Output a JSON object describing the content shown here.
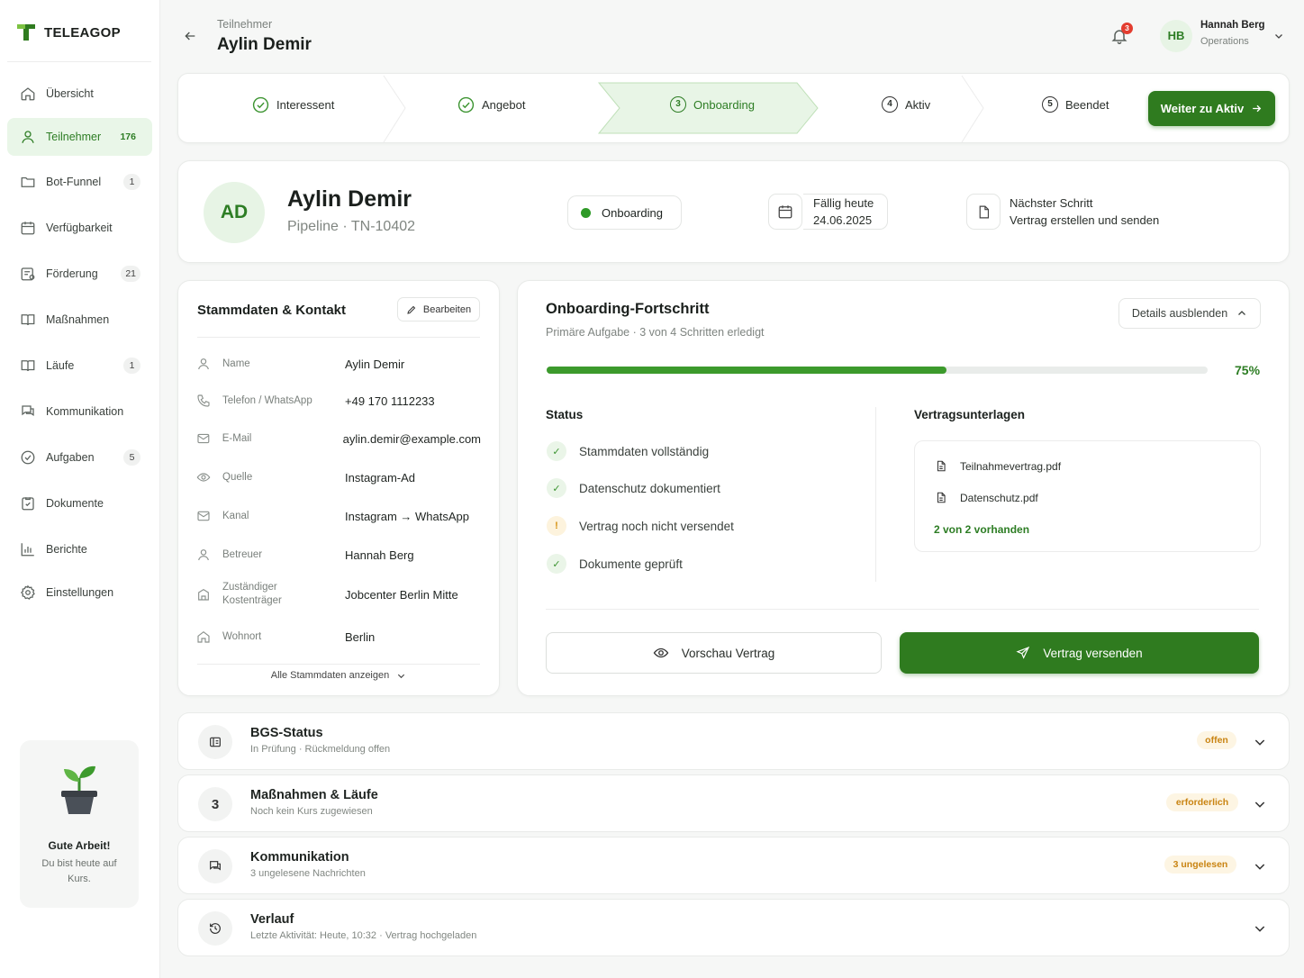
{
  "app": {
    "name": "TELEAGOP"
  },
  "sidebar": {
    "items": [
      {
        "label": "Übersicht",
        "badge": ""
      },
      {
        "label": "Teilnehmer",
        "badge": "176"
      },
      {
        "label": "Bot-Funnel",
        "badge": "1"
      },
      {
        "label": "Verfügbarkeit",
        "badge": ""
      },
      {
        "label": "Förderung",
        "badge": "21"
      },
      {
        "label": "Maßnahmen",
        "badge": ""
      },
      {
        "label": "Läufe",
        "badge": "1"
      },
      {
        "label": "Kommunikation",
        "badge": ""
      },
      {
        "label": "Aufgaben",
        "badge": "5"
      },
      {
        "label": "Dokumente",
        "badge": ""
      },
      {
        "label": "Berichte",
        "badge": ""
      },
      {
        "label": "Einstellungen",
        "badge": ""
      }
    ],
    "promo": {
      "title": "Gute Arbeit!",
      "text": "Du bist heute auf Kurs."
    }
  },
  "header": {
    "breadcrumb": "Teilnehmer",
    "title": "Aylin Demir",
    "notifications": "3",
    "user": {
      "initials": "HB",
      "name": "Hannah Berg",
      "role": "Operations"
    }
  },
  "stepper": {
    "steps": [
      {
        "number": "",
        "label": "Interessent"
      },
      {
        "number": "",
        "label": "Angebot"
      },
      {
        "number": "3",
        "label": "Onboarding"
      },
      {
        "number": "4",
        "label": "Aktiv"
      },
      {
        "number": "5",
        "label": "Beendet"
      }
    ],
    "next_button": "Weiter zu Aktiv"
  },
  "profile": {
    "initials": "AD",
    "name": "Aylin Demir",
    "pipeline": "Pipeline",
    "id": "TN-10402",
    "status": "Onboarding",
    "due_label": "Fällig heute",
    "due_date": "24.06.2025",
    "next_label": "Nächster Schritt",
    "next_value": "Vertrag erstellen und senden"
  },
  "stammdaten": {
    "title": "Stammdaten & Kontakt",
    "edit": "Bearbeiten",
    "rows": [
      {
        "label": "Name",
        "value": "Aylin Demir"
      },
      {
        "label": "Telefon / WhatsApp",
        "value": "+49 170 1112233"
      },
      {
        "label": "E-Mail",
        "value": "aylin.demir@example.com"
      },
      {
        "label": "Quelle",
        "value": "Instagram-Ad"
      },
      {
        "label": "Kanal",
        "value": "Instagram → WhatsApp"
      },
      {
        "label": "Betreuer",
        "value": "Hannah Berg"
      },
      {
        "label": "Zuständiger Kostenträger",
        "value": "Jobcenter Berlin Mitte"
      },
      {
        "label": "Wohnort",
        "value": "Berlin"
      }
    ],
    "show_all": "Alle Stammdaten anzeigen"
  },
  "onboarding": {
    "title": "Onboarding-Fortschritt",
    "subtitle_a": "Primäre Aufgabe",
    "subtitle_b": "3 von 4 Schritten erledigt",
    "toggle": "Details ausblenden",
    "progress": 75,
    "progress_label": "75%",
    "status_title": "Status",
    "status_items": [
      {
        "label": "Stammdaten vollständig",
        "state": "done"
      },
      {
        "label": "Datenschutz dokumentiert",
        "state": "done"
      },
      {
        "label": "Vertrag noch nicht versendet",
        "state": "warn"
      },
      {
        "label": "Dokumente geprüft",
        "state": "done"
      }
    ],
    "docs_title": "Vertragsunterlagen",
    "docs": [
      "Teilnahmevertrag.pdf",
      "Datenschutz.pdf"
    ],
    "docs_count": "2 von 2 vorhanden",
    "preview_button": "Vorschau Vertrag",
    "send_button": "Vertrag versenden"
  },
  "accordions": [
    {
      "icon": "",
      "title": "BGS-Status",
      "sub_a": "In Prüfung",
      "sub_b": "Rückmeldung offen",
      "tag": "offen"
    },
    {
      "icon": "3",
      "title": "Maßnahmen & Läufe",
      "sub_a": "Noch kein Kurs zugewiesen",
      "sub_b": "",
      "tag": "erforderlich"
    },
    {
      "icon": "",
      "title": "Kommunikation",
      "sub_a": "3 ungelesene Nachrichten",
      "sub_b": "",
      "tag": "3 ungelesen"
    },
    {
      "icon": "",
      "title": "Verlauf",
      "sub_a": "Letzte Aktivität: Heute, 10:32",
      "sub_b": "Vertrag hochgeladen",
      "tag": ""
    }
  ],
  "colors": {
    "accent": "#2f7b1f",
    "accent_light": "#e9f6e8",
    "warning": "#c98412",
    "danger": "#e33d2f"
  }
}
